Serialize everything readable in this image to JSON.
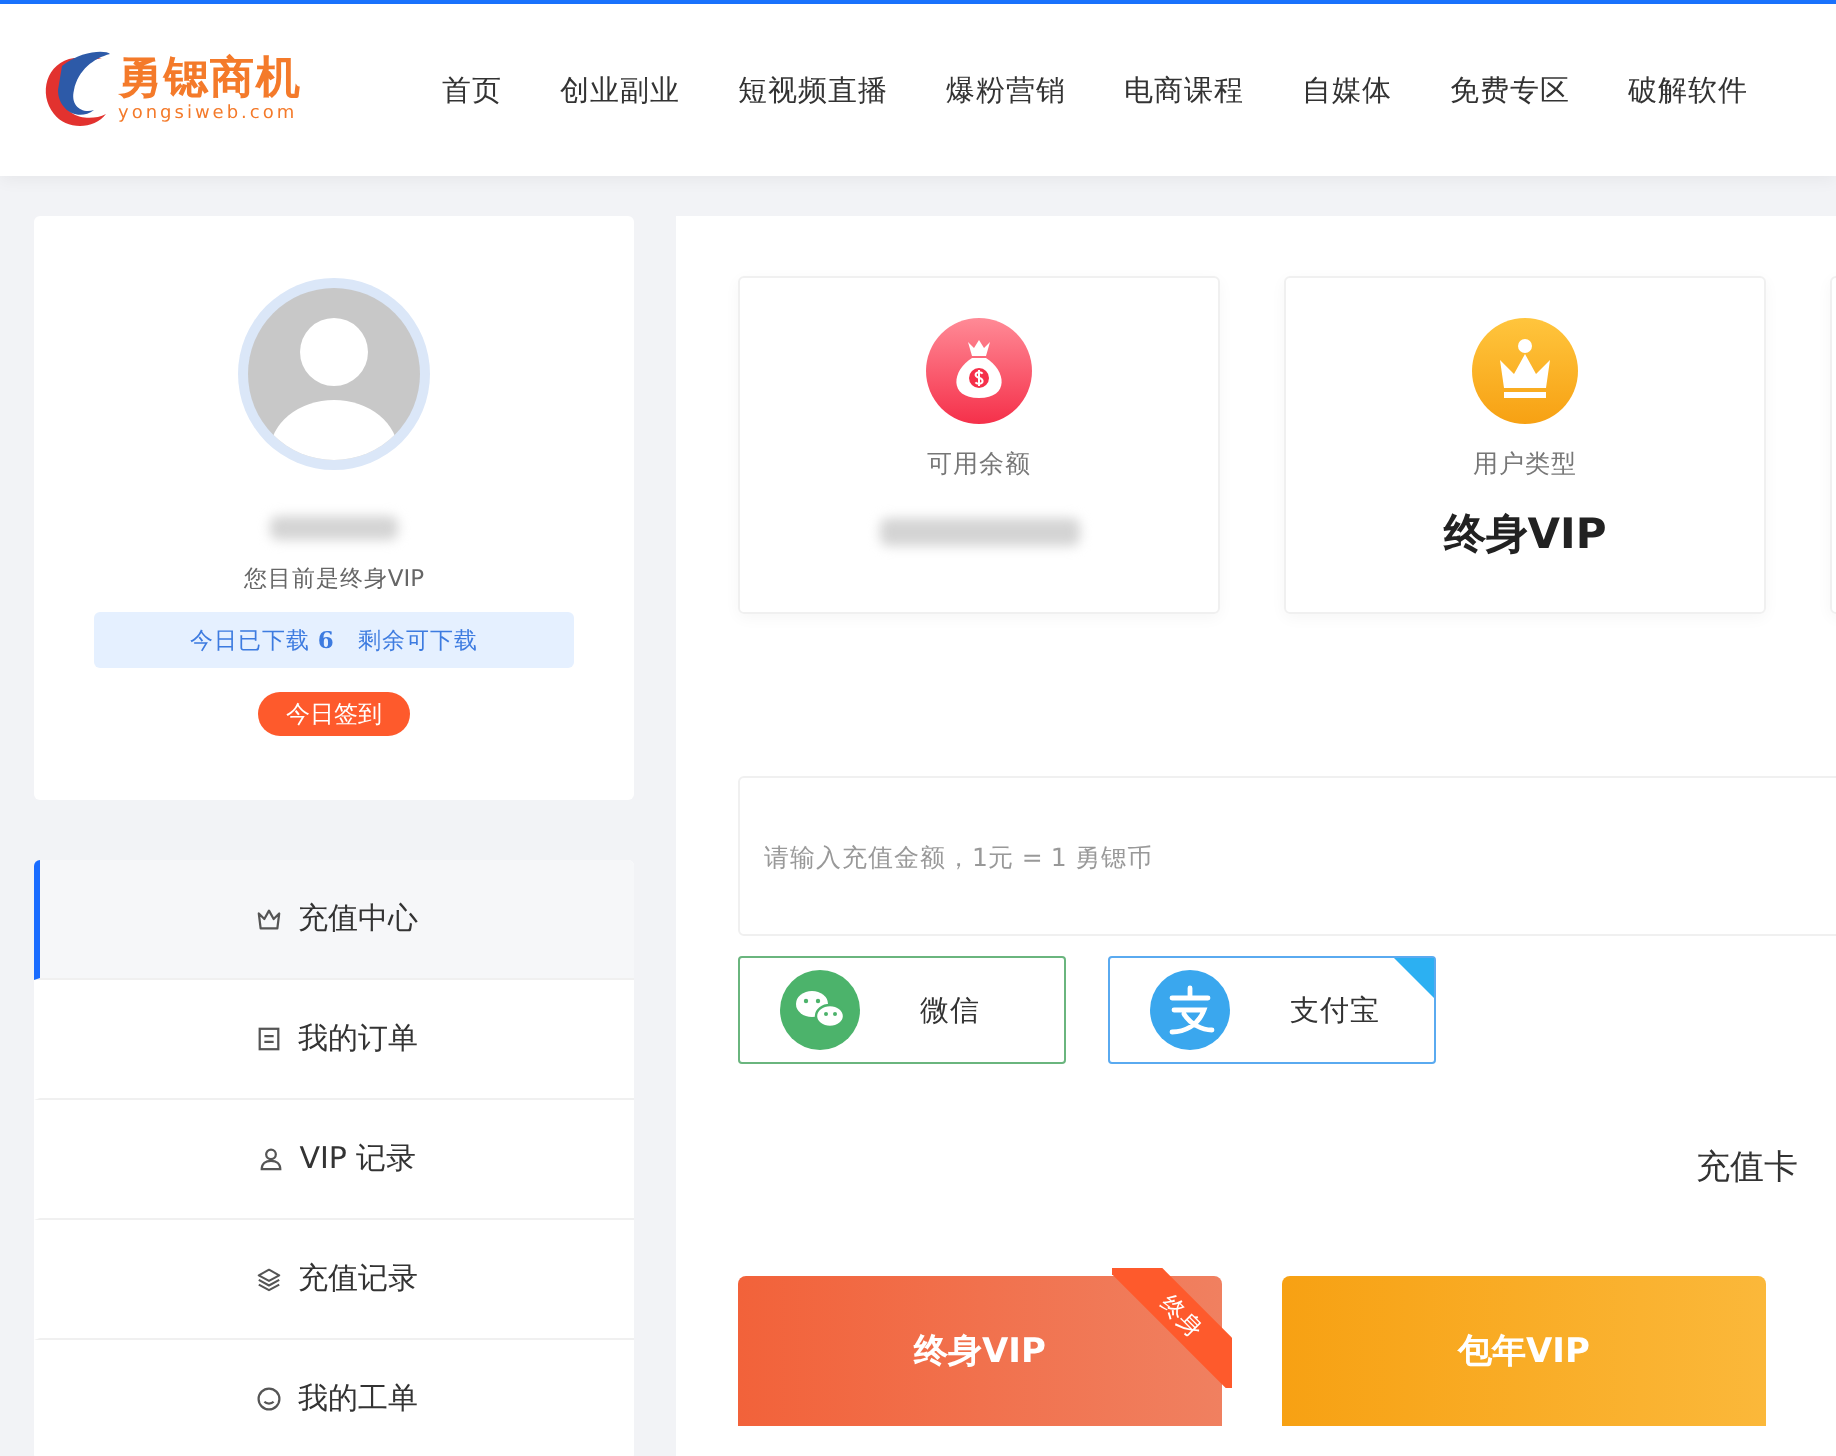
{
  "header": {
    "logo_text": "勇锶商机",
    "logo_domain": "yongsiweb.com",
    "nav": [
      {
        "label": "首页"
      },
      {
        "label": "创业副业"
      },
      {
        "label": "短视频直播"
      },
      {
        "label": "爆粉营销"
      },
      {
        "label": "电商课程"
      },
      {
        "label": "自媒体"
      },
      {
        "label": "免费专区"
      },
      {
        "label": "破解软件"
      }
    ]
  },
  "profile": {
    "vip_status": "您目前是终身VIP",
    "downloads": "今日已下载 **6**　剩余可下载",
    "checkin_button": "今日签到"
  },
  "menu": [
    {
      "label": "充值中心",
      "kind": "crown",
      "selected": true
    },
    {
      "label": "我的订单",
      "kind": "doc",
      "selected": false
    },
    {
      "label": "VIP 记录",
      "kind": "user",
      "selected": false
    },
    {
      "label": "充值记录",
      "kind": "layers",
      "selected": false
    },
    {
      "label": "我的工单",
      "kind": "smile",
      "selected": false
    }
  ],
  "stats": [
    {
      "kind": "balance",
      "label": "可用余额"
    },
    {
      "kind": "type",
      "label": "用户类型",
      "value": "终身VIP"
    }
  ],
  "recharge": {
    "placeholder": "请输入充值金额，1元 = 1 勇锶币",
    "methods": [
      {
        "kind": "wechat",
        "label": "微信",
        "selected": false
      },
      {
        "kind": "alipay",
        "label": "支付宝",
        "selected": true
      }
    ],
    "card_title": "充值卡"
  },
  "plans": [
    {
      "kind": "lifetime",
      "title": "终身VIP",
      "ribbon": "终身"
    },
    {
      "kind": "yearly",
      "title": "包年VIP"
    }
  ]
}
